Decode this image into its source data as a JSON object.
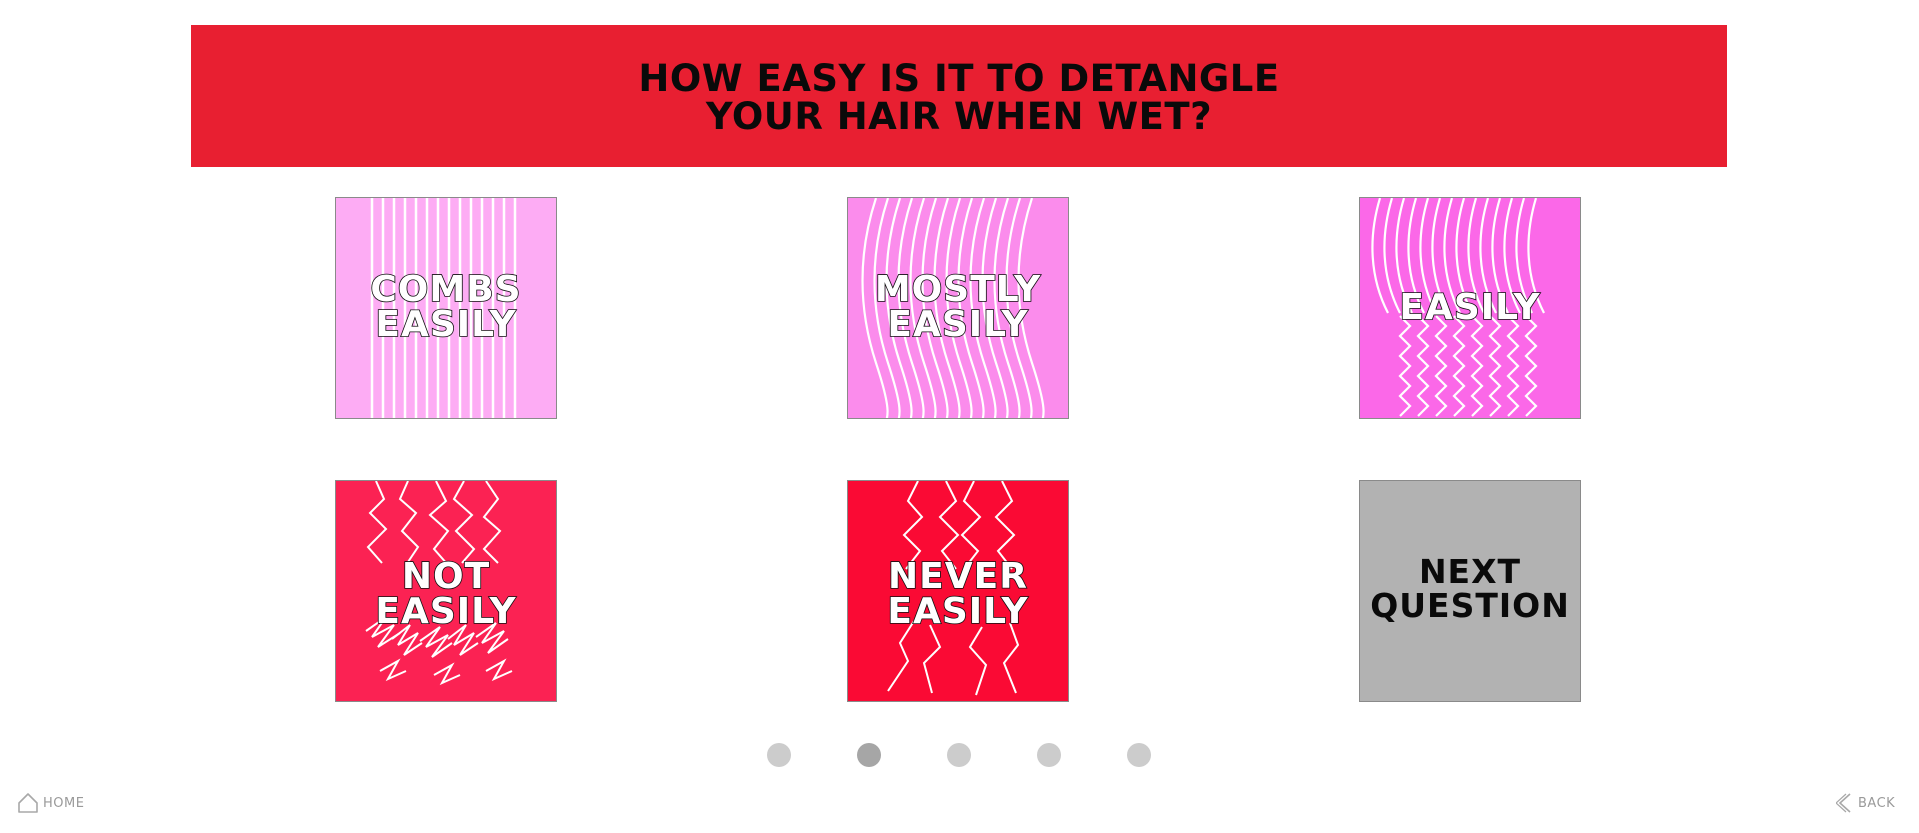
{
  "question": {
    "title": "HOW EASY IS IT TO DETANGLE\nYOUR HAIR WHEN WET?"
  },
  "options": [
    {
      "label": "COMBS\nEASILY",
      "color": "#fdacf4"
    },
    {
      "label": "MOSTLY\nEASILY",
      "color": "#fb8cec"
    },
    {
      "label": "EASILY",
      "color": "#fb68e8"
    },
    {
      "label": "NOT\nEASILY",
      "color": "#fb2253"
    },
    {
      "label": "NEVER\nEASILY",
      "color": "#fa0a34"
    }
  ],
  "next_question": {
    "label": "NEXT\nQUESTION",
    "color": "#b2b2b2"
  },
  "pager": {
    "total": 5,
    "active_index": 1
  },
  "footer": {
    "home_label": "HOME",
    "home_icon": "home-icon",
    "back_label": "BACK",
    "back_icon": "chevron-left-icon"
  },
  "colors": {
    "banner": "#e81f31",
    "dot": "#cccccc",
    "dot_active": "#a6a6a6"
  }
}
